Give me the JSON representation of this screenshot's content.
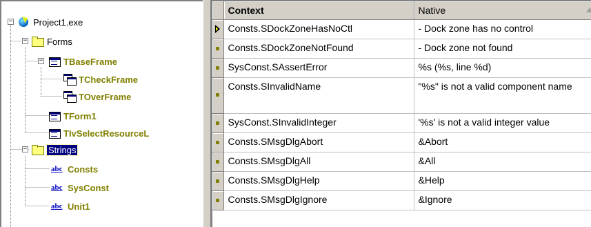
{
  "tree": {
    "project": {
      "label": "Project1.exe",
      "icon": "exe-icon",
      "expander": "−"
    },
    "forms": {
      "label": "Forms",
      "icon": "folder-icon",
      "expander": "−"
    },
    "items": [
      {
        "label": "TBaseFrame",
        "icon": "form-icon",
        "expander": "−"
      },
      {
        "label": "TCheckFrame",
        "icon": "frame-icon"
      },
      {
        "label": "TOverFrame",
        "icon": "frame-icon"
      },
      {
        "label": "TForm1",
        "icon": "form-icon"
      },
      {
        "label": "TIvSelectResourceL",
        "icon": "form-icon"
      }
    ],
    "strings": {
      "label": "Strings",
      "icon": "folder-icon",
      "expander": "−"
    },
    "units": [
      {
        "label": "Consts",
        "icon": "abc-icon",
        "glyph": "abc"
      },
      {
        "label": "SysConst",
        "icon": "abc-icon",
        "glyph": "abc"
      },
      {
        "label": "Unit1",
        "icon": "abc-icon",
        "glyph": "abc"
      }
    ]
  },
  "grid": {
    "columns": {
      "context": "Context",
      "native": "Native"
    },
    "rows": [
      {
        "context": "Consts.SDockZoneHasNoCtl",
        "native": "- Dock zone has no control",
        "current": true
      },
      {
        "context": "Consts.SDockZoneNotFound",
        "native": "- Dock zone not found"
      },
      {
        "context": "SysConst.SAssertError",
        "native": "%s (%s, line %d)"
      },
      {
        "context": "Consts.SInvalidName",
        "native": "\"%s\" is not a valid component name"
      },
      {
        "context": "SysConst.SInvalidInteger",
        "native": "'%s' is not a valid integer value"
      },
      {
        "context": "Consts.SMsgDlgAbort",
        "native": "&Abort"
      },
      {
        "context": "Consts.SMsgDlgAll",
        "native": "&All"
      },
      {
        "context": "Consts.SMsgDlgHelp",
        "native": "&Help"
      },
      {
        "context": "Consts.SMsgDlgIgnore",
        "native": "&Ignore"
      }
    ]
  },
  "colors": {
    "selection": "#000080",
    "bold_node": "#808000",
    "face": "#d4d0c8"
  }
}
